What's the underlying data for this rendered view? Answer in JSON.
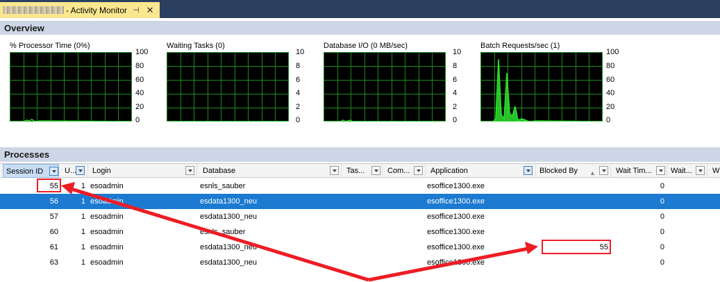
{
  "tab": {
    "title": "- Activity Monitor",
    "pin_icon": "pin-icon",
    "close_icon": "close-icon"
  },
  "overview": {
    "header": "Overview",
    "charts": [
      {
        "title": "% Processor Time (0%)",
        "ticks": [
          "100",
          "80",
          "60",
          "40",
          "20",
          "0"
        ]
      },
      {
        "title": "Waiting Tasks (0)",
        "ticks": [
          "10",
          "8",
          "6",
          "4",
          "2",
          "0"
        ]
      },
      {
        "title": "Database I/O (0 MB/sec)",
        "ticks": [
          "10",
          "8",
          "6",
          "4",
          "2",
          "0"
        ]
      },
      {
        "title": "Batch Requests/sec (1)",
        "ticks": [
          "100",
          "80",
          "60",
          "40",
          "20",
          "0"
        ]
      }
    ],
    "colors": {
      "plot_bg": "#000000",
      "grid": "#1c8a1c",
      "line": "#2ee02e"
    }
  },
  "processes": {
    "header": "Processes",
    "columns": [
      "Session ID",
      "U...",
      "Login",
      "Database",
      "Tas...",
      "Com...",
      "Application",
      "Blocked By",
      "Wait Tim...",
      "Wait...",
      "W"
    ],
    "rows": [
      {
        "session": "55",
        "u": "1",
        "login": "esoadmin",
        "database": "esnls_sauber",
        "application": "esoffice1300.exe",
        "blocked_by": "",
        "wait_time": "0"
      },
      {
        "session": "56",
        "u": "1",
        "login": "esoadmin",
        "database": "esdata1300_neu",
        "application": "esoffice1300.exe",
        "blocked_by": "",
        "wait_time": "0"
      },
      {
        "session": "57",
        "u": "1",
        "login": "esoadmin",
        "database": "esdata1300_neu",
        "application": "esoffice1300.exe",
        "blocked_by": "",
        "wait_time": "0"
      },
      {
        "session": "60",
        "u": "1",
        "login": "esoadmin",
        "database": "esnls_sauber",
        "application": "esoffice1300.exe",
        "blocked_by": "",
        "wait_time": "0"
      },
      {
        "session": "61",
        "u": "1",
        "login": "esoadmin",
        "database": "esdata1300_neu",
        "application": "esoffice1300.exe",
        "blocked_by": "55",
        "wait_time": "0"
      },
      {
        "session": "63",
        "u": "1",
        "login": "esoadmin",
        "database": "esdata1300_neu",
        "application": "esoffice1300.exe",
        "blocked_by": "",
        "wait_time": "0"
      }
    ],
    "selected_row": "56",
    "colors": {
      "selected": "#1c7ad0",
      "annotation": "#ee1c24"
    }
  }
}
